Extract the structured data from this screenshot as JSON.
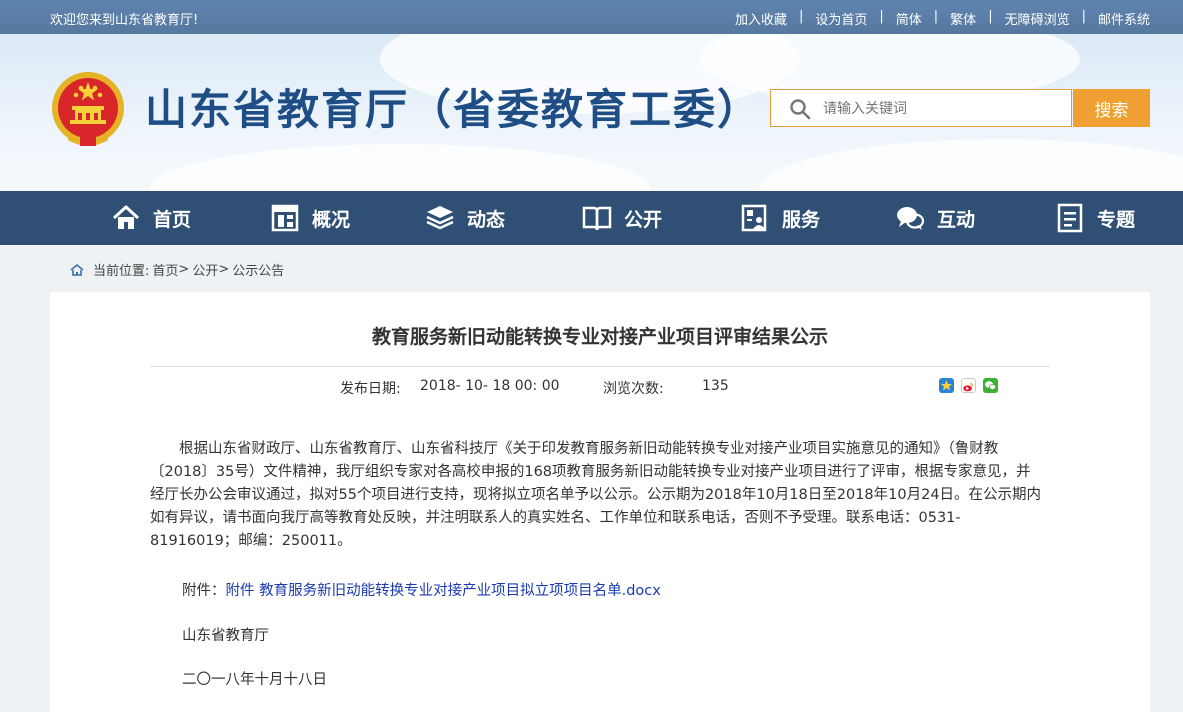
{
  "topbar": {
    "welcome": "欢迎您来到山东省教育厅!",
    "links": [
      "加入收藏",
      "设为首页",
      "简体",
      "繁体",
      "无障碍浏览",
      "邮件系统"
    ],
    "separator": "|"
  },
  "header": {
    "site_title": "山东省教育厅（省委教育工委）",
    "search_placeholder": "请输入关键词",
    "search_button": "搜索"
  },
  "nav": {
    "items": [
      {
        "label": "首页",
        "icon": "home-icon"
      },
      {
        "label": "概况",
        "icon": "building-icon"
      },
      {
        "label": "动态",
        "icon": "layers-icon"
      },
      {
        "label": "公开",
        "icon": "book-icon"
      },
      {
        "label": "服务",
        "icon": "service-icon"
      },
      {
        "label": "互动",
        "icon": "chat-icon"
      },
      {
        "label": "专题",
        "icon": "document-icon"
      }
    ]
  },
  "breadcrumb": {
    "prefix": "当前位置:",
    "items": [
      "首页",
      "公开",
      "公示公告"
    ],
    "separator": ">"
  },
  "article": {
    "title": "教育服务新旧动能转换专业对接产业项目评审结果公示",
    "publish_label": "发布日期:",
    "publish_date": "2018- 10- 18 00: 00",
    "views_label": "浏览次数:",
    "views": "135",
    "body": "根据山东省财政厅、山东省教育厅、山东省科技厅《关于印发教育服务新旧动能转换专业对接产业项目实施意见的通知》（鲁财教〔2018〕35号）文件精神，我厅组织专家对各高校申报的168项教育服务新旧动能转换专业对接产业项目进行了评审，根据专家意见，并经厅长办公会审议通过，拟对55个项目进行支持，现将拟立项名单予以公示。公示期为2018年10月18日至2018年10月24日。在公示期内如有异议，请书面向我厅高等教育处反映，并注明联系人的真实姓名、工作单位和联系电话，否则不予受理。联系电话：0531-81916019；邮编：250011。",
    "attachment_label": "附件：",
    "attachment_link": "附件 教育服务新旧动能转换专业对接产业项目拟立项项目名单.docx",
    "signature": "山东省教育厅",
    "date": "二〇一八年十月十八日"
  },
  "colors": {
    "topbar": "#5a7ea8",
    "nav": "#2f4f74",
    "title": "#1f4e86",
    "search_button": "#f0a030",
    "link": "#1a3bb0"
  }
}
